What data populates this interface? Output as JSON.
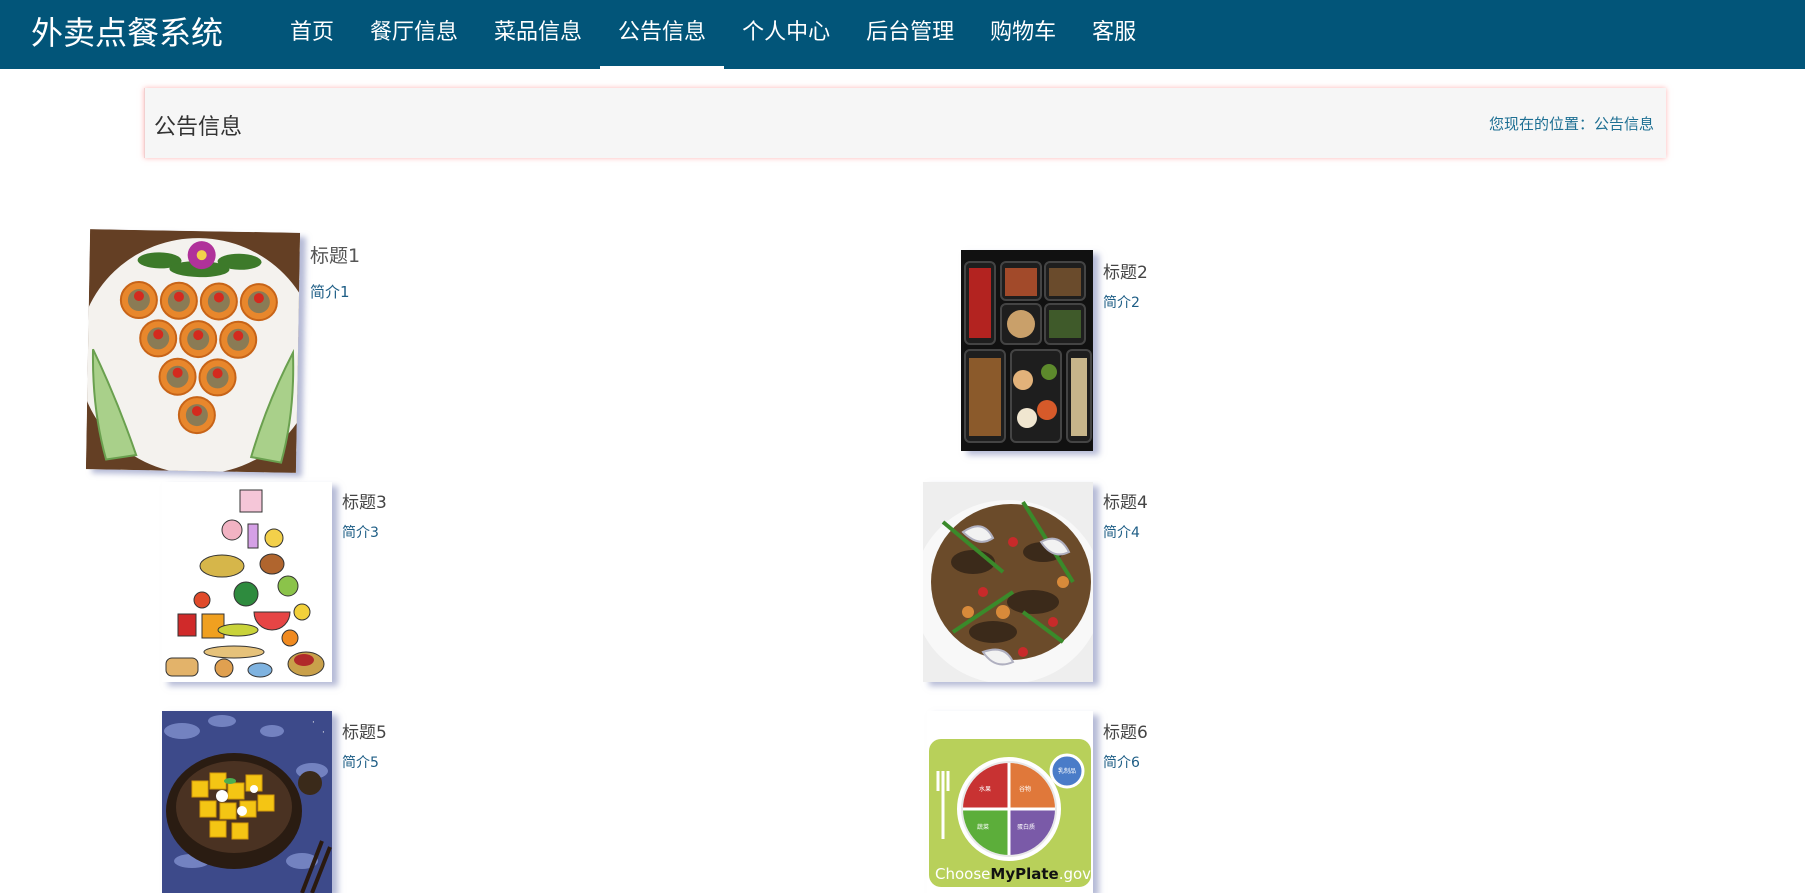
{
  "brand": "外卖点餐系统",
  "nav": [
    {
      "label": "首页",
      "active": false
    },
    {
      "label": "餐厅信息",
      "active": false
    },
    {
      "label": "菜品信息",
      "active": false
    },
    {
      "label": "公告信息",
      "active": true
    },
    {
      "label": "个人中心",
      "active": false
    },
    {
      "label": "后台管理",
      "active": false
    },
    {
      "label": "购物车",
      "active": false
    },
    {
      "label": "客服",
      "active": false
    }
  ],
  "breadcrumb": {
    "title": "公告信息",
    "location_prefix": "您现在的位置：",
    "location_current": "公告信息"
  },
  "notices": [
    {
      "title": "标题1",
      "intro": "简介1",
      "image": "food-platter-photo"
    },
    {
      "title": "标题2",
      "intro": "简介2",
      "image": "bento-box-photo"
    },
    {
      "title": "标题3",
      "intro": "简介3",
      "image": "food-pyramid-illustration"
    },
    {
      "title": "标题4",
      "intro": "简介4",
      "image": "stir-fry-dish-photo"
    },
    {
      "title": "标题5",
      "intro": "简介5",
      "image": "mango-dessert-photo"
    },
    {
      "title": "标题6",
      "intro": "简介6",
      "image": "myplate-logo"
    }
  ],
  "myplate": {
    "brand_choose": "Choose",
    "brand_myplate": "MyPlate",
    "brand_gov": ".gov",
    "labels": [
      "水果",
      "谷物",
      "蔬菜",
      "蛋白质",
      "乳制品"
    ]
  },
  "colors": {
    "nav_bg": "#025579",
    "breadcrumb_bg": "#f6f6f6",
    "link": "#1d6f93"
  }
}
